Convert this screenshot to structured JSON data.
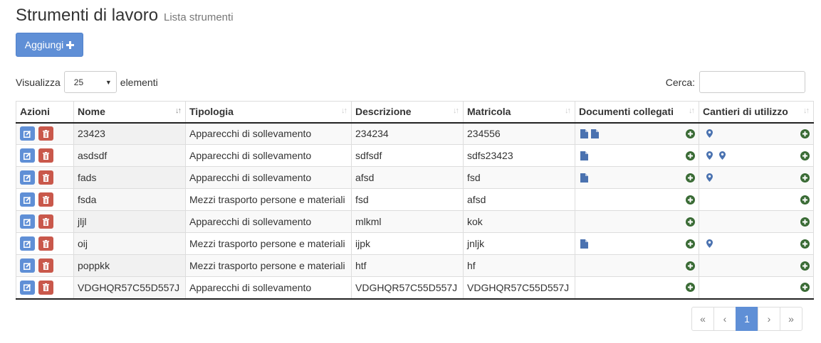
{
  "header": {
    "title": "Strumenti di lavoro",
    "subtitle": "Lista strumenti"
  },
  "toolbar": {
    "add_label": "Aggiungi",
    "add_icon": "plus-icon"
  },
  "length": {
    "prefix": "Visualizza",
    "value": "25",
    "suffix": "elementi"
  },
  "search": {
    "label": "Cerca:",
    "value": ""
  },
  "colors": {
    "primary": "#5f8fd6",
    "danger": "#c9584b",
    "success": "#3a6b35",
    "doc_icon": "#4a72b0"
  },
  "table": {
    "columns": [
      "Azioni",
      "Nome",
      "Tipologia",
      "Descrizione",
      "Matricola",
      "Documenti collegati",
      "Cantieri di utilizzo"
    ],
    "sorted_column": "Nome",
    "rows": [
      {
        "nome": "23423",
        "tipologia": "Apparecchi di sollevamento",
        "descrizione": "234234",
        "matricola": "234556",
        "docs": 2,
        "cantieri": 1
      },
      {
        "nome": "asdsdf",
        "tipologia": "Apparecchi di sollevamento",
        "descrizione": "sdfsdf",
        "matricola": "sdfs23423",
        "docs": 1,
        "cantieri": 2
      },
      {
        "nome": "fads",
        "tipologia": "Apparecchi di sollevamento",
        "descrizione": "afsd",
        "matricola": "fsd",
        "docs": 1,
        "cantieri": 1
      },
      {
        "nome": "fsda",
        "tipologia": "Mezzi trasporto persone e materiali",
        "descrizione": "fsd",
        "matricola": "afsd",
        "docs": 0,
        "cantieri": 0
      },
      {
        "nome": "jljl",
        "tipologia": "Apparecchi di sollevamento",
        "descrizione": "mlkml",
        "matricola": "kok",
        "docs": 0,
        "cantieri": 0
      },
      {
        "nome": "oij",
        "tipologia": "Mezzi trasporto persone e materiali",
        "descrizione": "ijpk",
        "matricola": "jnljk",
        "docs": 1,
        "cantieri": 1
      },
      {
        "nome": "poppkk",
        "tipologia": "Mezzi trasporto persone e materiali",
        "descrizione": "htf",
        "matricola": "hf",
        "docs": 0,
        "cantieri": 0
      },
      {
        "nome": "VDGHQR57C55D557J",
        "tipologia": "Apparecchi di sollevamento",
        "descrizione": "VDGHQR57C55D557J",
        "matricola": "VDGHQR57C55D557J",
        "docs": 0,
        "cantieri": 0
      }
    ]
  },
  "pagination": {
    "first": "«",
    "prev": "‹",
    "current": "1",
    "next": "›",
    "last": "»"
  }
}
